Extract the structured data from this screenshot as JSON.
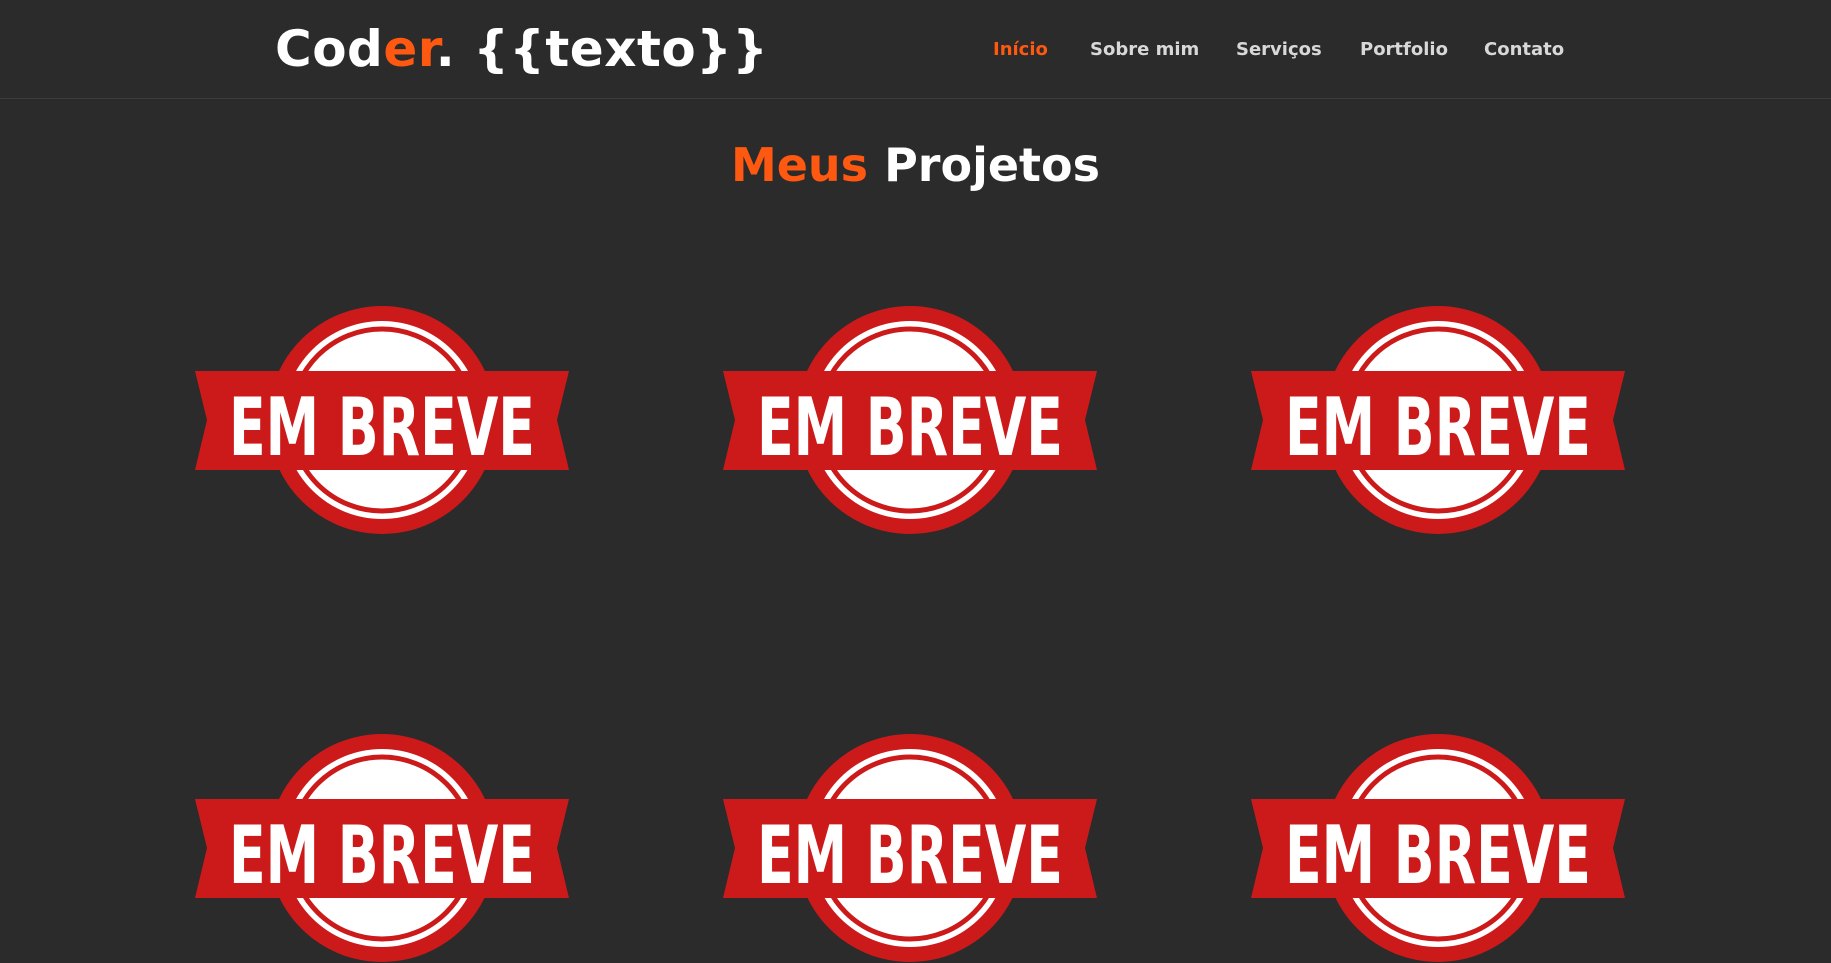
{
  "header": {
    "logo": {
      "part1": "Cod",
      "part2": "er",
      "part3": ". {{texto}}"
    },
    "nav": [
      {
        "label": "Início",
        "active": true
      },
      {
        "label": "Sobre mim",
        "active": false
      },
      {
        "label": "Serviços",
        "active": false
      },
      {
        "label": "Portfolio",
        "active": false
      },
      {
        "label": "Contato",
        "active": false
      }
    ]
  },
  "portfolio": {
    "title_accent": "Meus",
    "title_rest": "Projetos",
    "projects": [
      {
        "badge_text": "EM BREVE"
      },
      {
        "badge_text": "EM BREVE"
      },
      {
        "badge_text": "EM BREVE"
      },
      {
        "badge_text": "EM BREVE"
      },
      {
        "badge_text": "EM BREVE"
      },
      {
        "badge_text": "EM BREVE"
      }
    ]
  },
  "colors": {
    "background": "#2b2b2b",
    "accent": "#ff5810",
    "badge_red": "#cc1a1a",
    "text": "#ffffff"
  }
}
